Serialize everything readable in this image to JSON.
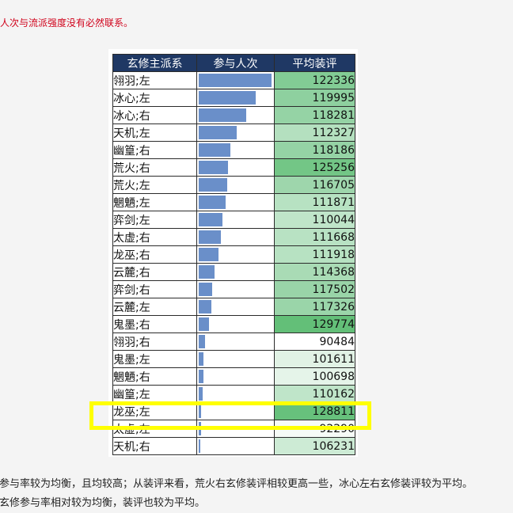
{
  "top_note": "与人次与流派强度没有必然联系。",
  "table": {
    "headers": [
      "玄修主派系",
      "参与人次",
      "平均装评"
    ],
    "rows": [
      {
        "school": "翎羽;左",
        "participation": 1.0,
        "score": "122336",
        "score_color": "#82cc95"
      },
      {
        "school": "冰心;左",
        "participation": 0.78,
        "score": "119995",
        "score_color": "#8ed09f"
      },
      {
        "school": "冰心;右",
        "participation": 0.65,
        "score": "118281",
        "score_color": "#95d3a5"
      },
      {
        "school": "天机;左",
        "participation": 0.52,
        "score": "112327",
        "score_color": "#b4e0bf"
      },
      {
        "school": "幽篁;右",
        "participation": 0.44,
        "score": "118186",
        "score_color": "#95d3a5"
      },
      {
        "school": "荒火;右",
        "participation": 0.4,
        "score": "125256",
        "score_color": "#73c686"
      },
      {
        "school": "荒火;左",
        "participation": 0.39,
        "score": "116705",
        "score_color": "#9ed6ac"
      },
      {
        "school": "魍魉;左",
        "participation": 0.37,
        "score": "111871",
        "score_color": "#b7e2c2"
      },
      {
        "school": "弈剑;左",
        "participation": 0.33,
        "score": "110044",
        "score_color": "#bfe5c9"
      },
      {
        "school": "太虚;右",
        "participation": 0.3,
        "score": "111668",
        "score_color": "#b8e2c3"
      },
      {
        "school": "龙巫;右",
        "participation": 0.27,
        "score": "111918",
        "score_color": "#b7e2c2"
      },
      {
        "school": "云麓;右",
        "participation": 0.22,
        "score": "114368",
        "score_color": "#a9dbb5"
      },
      {
        "school": "弈剑;右",
        "participation": 0.19,
        "score": "117502",
        "score_color": "#99d4a8"
      },
      {
        "school": "云麓;左",
        "participation": 0.17,
        "score": "117326",
        "score_color": "#9ad5a9"
      },
      {
        "school": "鬼墨;右",
        "participation": 0.14,
        "score": "129774",
        "score_color": "#63bf78"
      },
      {
        "school": "翎羽;右",
        "participation": 0.09,
        "score": "90484",
        "score_color": "#ffffff"
      },
      {
        "school": "鬼墨;左",
        "participation": 0.07,
        "score": "101611",
        "score_color": "#e1f2e5"
      },
      {
        "school": "魍魉;右",
        "participation": 0.06,
        "score": "100698",
        "score_color": "#e5f4e9"
      },
      {
        "school": "幽篁;左",
        "participation": 0.05,
        "score": "110162",
        "score_color": "#bfe5c9"
      },
      {
        "school": "龙巫;左",
        "participation": 0.03,
        "score": "128811",
        "score_color": "#67c17c"
      },
      {
        "school": "太虚;左",
        "participation": 0.03,
        "score": "92290",
        "score_color": "#f6fbf7"
      },
      {
        "school": "天机;右",
        "participation": 0.02,
        "score": "106231",
        "score_color": "#cdebd5"
      }
    ]
  },
  "bottom": {
    "line1": "派参与率较为均衡，且均较高；从装评来看，荒火右玄修装评相较更高一些，冰心左右玄修装评较为平均。",
    "line2": "右玄修参与率相对较为均衡，装评也较为平均。"
  },
  "colors": {
    "header_bg": "#1f3864",
    "bar": "#6a8fc9",
    "highlight": "#ffff00",
    "note_red": "#d0021b"
  }
}
